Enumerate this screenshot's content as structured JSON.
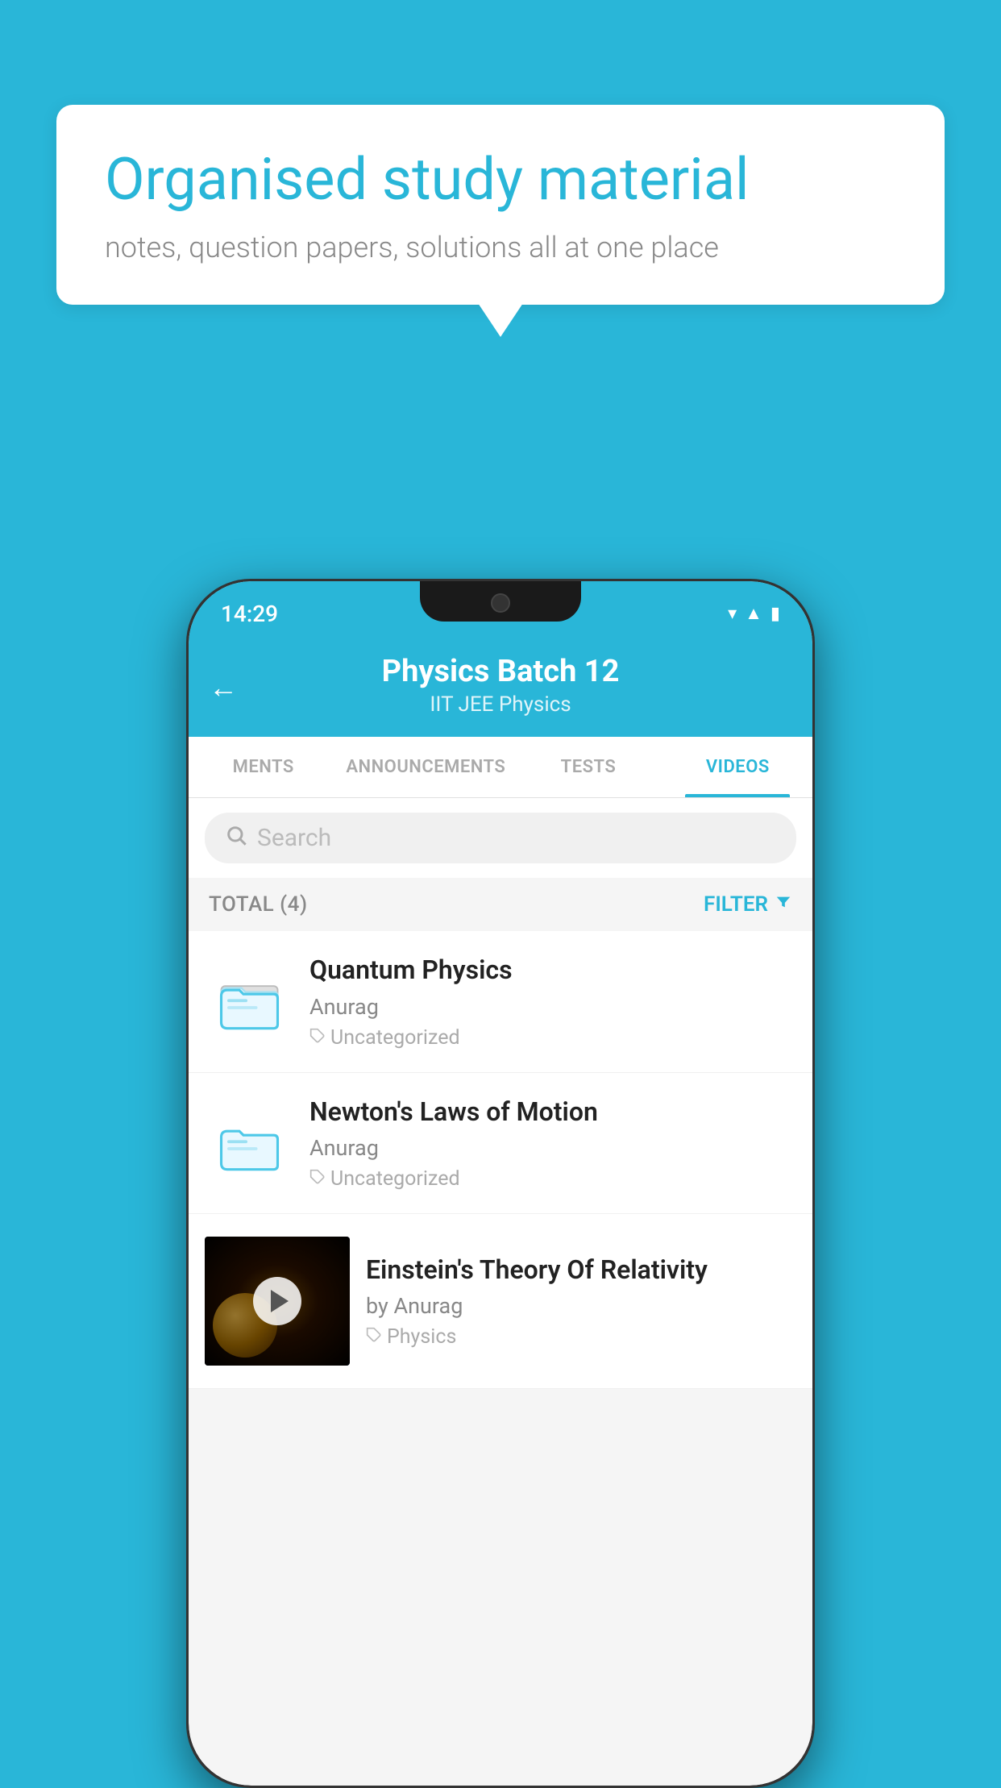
{
  "background_color": "#29b6d8",
  "speech_bubble": {
    "title": "Organised study material",
    "subtitle": "notes, question papers, solutions all at one place"
  },
  "phone": {
    "status_bar": {
      "time": "14:29",
      "icons": [
        "wifi",
        "signal",
        "battery"
      ]
    },
    "header": {
      "title": "Physics Batch 12",
      "subtitle": "IIT JEE    Physics",
      "back_label": "←"
    },
    "tabs": [
      {
        "label": "MENTS",
        "active": false
      },
      {
        "label": "ANNOUNCEMENTS",
        "active": false
      },
      {
        "label": "TESTS",
        "active": false
      },
      {
        "label": "VIDEOS",
        "active": true
      }
    ],
    "search": {
      "placeholder": "Search"
    },
    "filter_bar": {
      "total_label": "TOTAL (4)",
      "filter_label": "FILTER"
    },
    "videos": [
      {
        "id": 1,
        "title": "Quantum Physics",
        "author": "Anurag",
        "tag": "Uncategorized",
        "type": "folder"
      },
      {
        "id": 2,
        "title": "Newton's Laws of Motion",
        "author": "Anurag",
        "tag": "Uncategorized",
        "type": "folder"
      },
      {
        "id": 3,
        "title": "Einstein's Theory Of Relativity",
        "author": "by Anurag",
        "tag": "Physics",
        "type": "video"
      }
    ]
  }
}
